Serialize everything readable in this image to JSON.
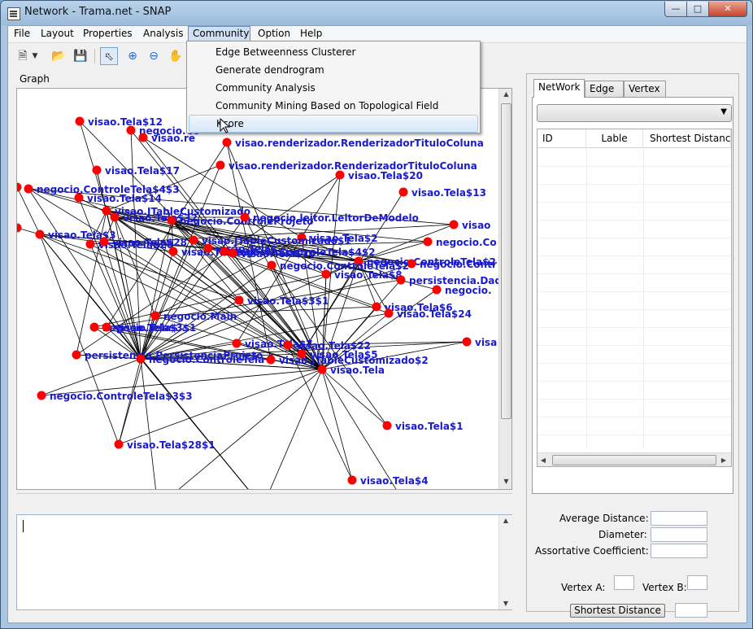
{
  "window": {
    "title": "Network - Trama.net - SNAP"
  },
  "menubar": [
    {
      "label": "File"
    },
    {
      "label": "Layout"
    },
    {
      "label": "Properties"
    },
    {
      "label": "Analysis"
    },
    {
      "label": "Community",
      "active": true
    },
    {
      "label": "Option"
    },
    {
      "label": "Help"
    }
  ],
  "community_menu": {
    "items": [
      {
        "label": "Edge Betweenness Clusterer"
      },
      {
        "label": "Generate dendrogram"
      },
      {
        "label": "Community Analysis"
      },
      {
        "label": "Community Mining Based on Topological Field"
      },
      {
        "label": "Kcore",
        "hovered": true
      }
    ]
  },
  "toolbar": {
    "icons": [
      "new-file-icon",
      "dropdown-arrow-icon",
      "open-folder-icon",
      "save-icon",
      "pointer-icon",
      "zoom-in-icon",
      "zoom-out-icon",
      "pan-hand-icon"
    ],
    "selected": "pointer-icon"
  },
  "graph": {
    "label": "Graph",
    "node_color": "#ff0000",
    "label_color": "#1a1ad0",
    "edge_color": "#000000",
    "nodes": [
      {
        "label": "visao.Tela$12"
      },
      {
        "label": "negocio.Co"
      },
      {
        "label": "visao.re"
      },
      {
        "label": "visao.renderizador.RenderizadorTituloColuna"
      },
      {
        "label": "visao.Tela$17"
      },
      {
        "label": "visao.renderizador.RenderizadorTituloColuna"
      },
      {
        "label": "visao.Tela$20"
      },
      {
        "label": "visao.Tela$14"
      },
      {
        "label": "visao.Tela$13"
      },
      {
        "label": "negocio.ControleTela$4$3"
      },
      {
        "label": "visao.JTableCustomizado"
      },
      {
        "label": "visao.Tela$32"
      },
      {
        "label": "negocio.ControleProjeto"
      },
      {
        "label": "negocio.leitor.LeitorDeModelo"
      },
      {
        "label": "visao"
      },
      {
        "label": "visao.Tela$3"
      },
      {
        "label": "visao.Tela$26"
      },
      {
        "label": "visao.Tela$2"
      },
      {
        "label": "visao.Tela$28"
      },
      {
        "label": "visao.Tela$27"
      },
      {
        "label": "visao.JTableCustomizado$1"
      },
      {
        "label": "negocio.Co"
      },
      {
        "label": "visao.Tela$..."
      },
      {
        "label": "negocio.ControleTela$4$2"
      },
      {
        "label": "visao.Tela$10"
      },
      {
        "label": "negocio.ControleTela$2"
      },
      {
        "label": "negocio.Contr"
      },
      {
        "label": "negocio.ControleTela$2"
      },
      {
        "label": "visao.Tela$8"
      },
      {
        "label": "persistencia.Dad"
      },
      {
        "label": "negocio."
      },
      {
        "label": "visao.Tela$3$1"
      },
      {
        "label": "visao.Tela$6"
      },
      {
        "label": "visao.Tela$24"
      },
      {
        "label": "negocio.Main"
      },
      {
        "label": "negocio.Tela$..."
      },
      {
        "label": "visao.Tela$3$1"
      },
      {
        "label": "visa"
      },
      {
        "label": "visao.Tela$7"
      },
      {
        "label": "visao.Tela$22"
      },
      {
        "label": "persistencia.PersistenciaProjeto"
      },
      {
        "label": "visao.Tela$5"
      },
      {
        "label": "negocio.ControleTela"
      },
      {
        "label": "visao.JTableCustomizado$2"
      },
      {
        "label": "visao.Tela"
      },
      {
        "label": "negocio.ControleTela$3$3"
      },
      {
        "label": "visao.Tela$1"
      },
      {
        "label": "visao.Tela$28$1"
      },
      {
        "label": "visao.Tela$4"
      },
      {
        "label": "negocio.Matriz"
      },
      {
        "label": ""
      },
      {
        "label": ""
      },
      {
        "label": ""
      },
      {
        "label": ""
      }
    ]
  },
  "tabs": [
    {
      "label": "NetWork",
      "active": true
    },
    {
      "label": "Edge"
    },
    {
      "label": "Vertex"
    }
  ],
  "network_table": {
    "columns": [
      "ID",
      "Lable",
      "Shortest Distance"
    ]
  },
  "stats": {
    "average_distance_label": "Average Distance:",
    "diameter_label": "Diameter:",
    "assortative_label": "Assortative Coefficient:",
    "vertex_a_label": "Vertex A:",
    "vertex_b_label": "Vertex B:",
    "shortest_button": "Shortest Distance"
  }
}
